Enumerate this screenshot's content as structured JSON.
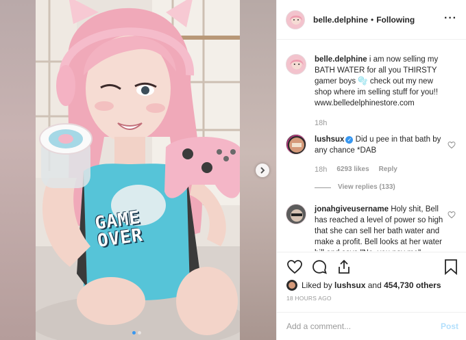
{
  "header": {
    "username": "belle.delphine",
    "separator": "•",
    "follow_status": "Following",
    "more_icon": "more-dots-icon"
  },
  "caption": {
    "username": "belle.delphine",
    "text": "i am now selling my BATH WATER for all you THIRSTY gamer boys",
    "emoji": "bubbles-emoji",
    "text2": "check out my new shop where im selling stuff for you!! www.belledelphinestore.com",
    "time": "18h"
  },
  "comments": [
    {
      "username": "lushsux",
      "verified": true,
      "text": "Did u pee in that bath by any chance *DAB",
      "time": "18h",
      "likes": "6293 likes",
      "reply": "Reply",
      "view_replies": "View replies (133)"
    },
    {
      "username": "jonahgiveusername",
      "text": "Holy shit, Bell has reached a level of power so high that she can sell her bath water and make a profit. Bell looks at her water bill and says \"No, you pay me\""
    }
  ],
  "actions": {
    "like_icon": "heart-icon",
    "comment_icon": "comment-icon",
    "share_icon": "share-icon",
    "save_icon": "bookmark-icon"
  },
  "likes": {
    "prefix": "Liked by",
    "user": "lushsux",
    "and": "and",
    "count": "454,730 others"
  },
  "time_ago": "18 HOURS AGO",
  "add_comment": {
    "placeholder": "Add a comment...",
    "post_label": "Post"
  },
  "media": {
    "shirt_text_1": "GAME",
    "shirt_text_2": "OVER",
    "carousel_total": 2,
    "carousel_active": 1,
    "next_icon": "chevron-right-icon"
  },
  "colors": {
    "accent": "#3897f0",
    "post_disabled": "#b2dffc",
    "hair_pink": "#f2aebd",
    "controller_pink": "#f4b8c8",
    "shirt_teal": "#4fc3d9"
  }
}
